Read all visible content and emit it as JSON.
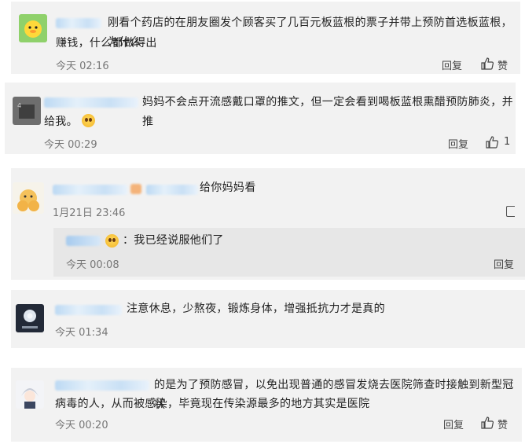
{
  "comments": [
    {
      "text_line1": "刚看个药店的在朋友圈发个顾客买了几百元板蓝根的票子并带上预防首选板蓝根，为什么",
      "text_line2": "赚钱，什么都做得出",
      "time": "今天 02:16",
      "reply_label": "回复",
      "like_label": "赞"
    },
    {
      "text_line1": "妈妈不会点开流感戴口罩的推文，但一定会看到喝板蓝根熏醋预防肺炎，并推",
      "text_line2": "给我。",
      "time": "今天 00:29",
      "reply_label": "回复",
      "like_count": "1"
    },
    {
      "text_line1": "给你妈妈看",
      "time": "1月21日 23:46",
      "nested_reply": {
        "text": "：我已经说服他们了",
        "time": "今天 00:08",
        "reply_label": "回复"
      }
    },
    {
      "text_line1": "注意休息，少熬夜，锻炼身体，增强抵抗力才是真的",
      "time": "今天 01:34"
    },
    {
      "text_line1": "的是为了预防感冒，以免出现普通的感冒发烧去医院筛查时接触到新型冠状",
      "text_line2": "病毒的人，从而被感染，毕竟现在传染源最多的地方其实是医院",
      "time": "今天 00:20",
      "reply_label": "回复",
      "like_label": "赞"
    }
  ],
  "icons": [
    "thumbs-up-icon",
    "smiley-emoji-icon",
    "reply-icon"
  ]
}
